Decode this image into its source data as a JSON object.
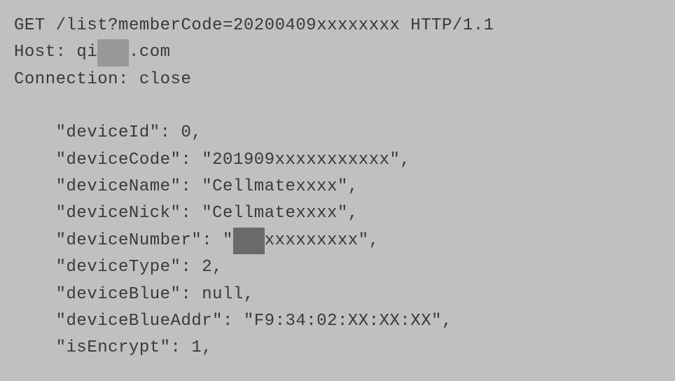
{
  "request": {
    "method": "GET",
    "path_prefix": " /list?memberCode=",
    "member_code": "20200409xxxxxxxx",
    "http_version": " HTTP/1.1",
    "host_label": "Host: ",
    "host_prefix": "qi",
    "host_redacted": "   ",
    "host_suffix": ".com",
    "connection_label": "Connection: ",
    "connection_value": "close"
  },
  "fields": {
    "indent": "    ",
    "device_id_key": "\"deviceId\": ",
    "device_id_value": "0,",
    "device_code_key": "\"deviceCode\": ",
    "device_code_value": "\"201909xxxxxxxxxxx\",",
    "device_name_key": "\"deviceName\": ",
    "device_name_value": "\"Cellmatexxxx\",",
    "device_nick_key": "\"deviceNick\": ",
    "device_nick_value": "\"Cellmatexxxx\",",
    "device_number_key": "\"deviceNumber\": ",
    "device_number_value_prefix": "\"",
    "device_number_redacted": "   ",
    "device_number_value_suffix": "xxxxxxxxx\",",
    "device_type_key": "\"deviceType\": ",
    "device_type_value": "2,",
    "device_blue_key": "\"deviceBlue\": ",
    "device_blue_value": "null,",
    "device_blue_addr_key": "\"deviceBlueAddr\": ",
    "device_blue_addr_value": "\"F9:34:02:XX:XX:XX\",",
    "is_encrypt_key": "\"isEncrypt\": ",
    "is_encrypt_value": "1,"
  }
}
